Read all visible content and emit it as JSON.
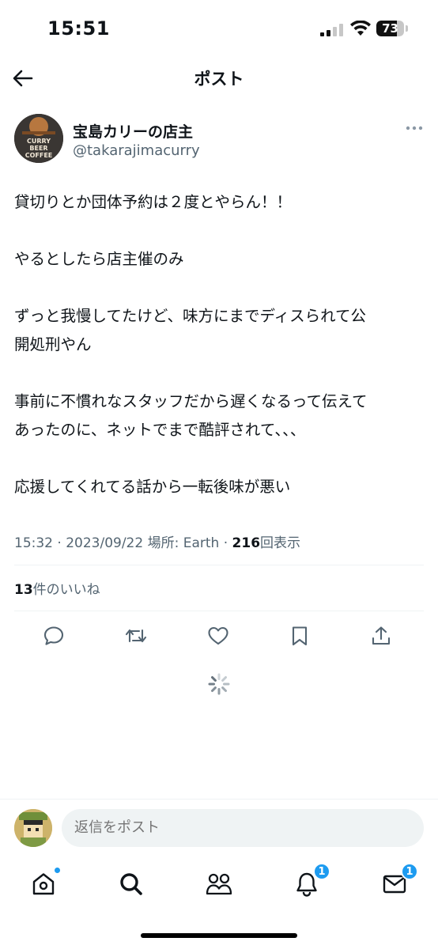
{
  "status_bar": {
    "time": "15:51",
    "battery": "73",
    "battery_level": 0.73
  },
  "header": {
    "title": "ポスト"
  },
  "author": {
    "display_name": "宝島カリーの店主",
    "handle": "@takarajimacurry",
    "avatar_text": [
      "CURRY",
      "BEER",
      "COFFEE"
    ]
  },
  "tweet": {
    "paragraphs": [
      [
        "貸切りとか団体予約は２度とやらん！！"
      ],
      [
        "やるとしたら店主催のみ"
      ],
      [
        "ずっと我慢してたけど、味方にまでディスられて公",
        "開処刑やん"
      ],
      [
        "事前に不慣れなスタッフだから遅くなるって伝えて",
        "あったのに、ネットでまで酷評されて、、、"
      ],
      [
        "応援してくれてる話から一転後味が悪い"
      ]
    ],
    "meta_prefix": "15:32 · 2023/09/22 場所: Earth · ",
    "views_count": "216",
    "views_label": "回表示",
    "likes_count": "13",
    "likes_label": "件のいいね"
  },
  "actions": [
    "reply-icon",
    "repost-icon",
    "like-icon",
    "bookmark-icon",
    "share-icon"
  ],
  "reply_bar": {
    "placeholder": "返信をポスト"
  },
  "tab_bar": {
    "items": [
      {
        "icon": "home-icon",
        "badge": ""
      },
      {
        "icon": "search-icon",
        "badge": ""
      },
      {
        "icon": "communities-icon",
        "badge": ""
      },
      {
        "icon": "notifications-icon",
        "badge": "1"
      },
      {
        "icon": "messages-icon",
        "badge": "1"
      }
    ]
  },
  "colors": {
    "accent": "#1d9bf0",
    "text": "#0f1419",
    "secondary": "#536471",
    "divider": "#eff3f4"
  }
}
